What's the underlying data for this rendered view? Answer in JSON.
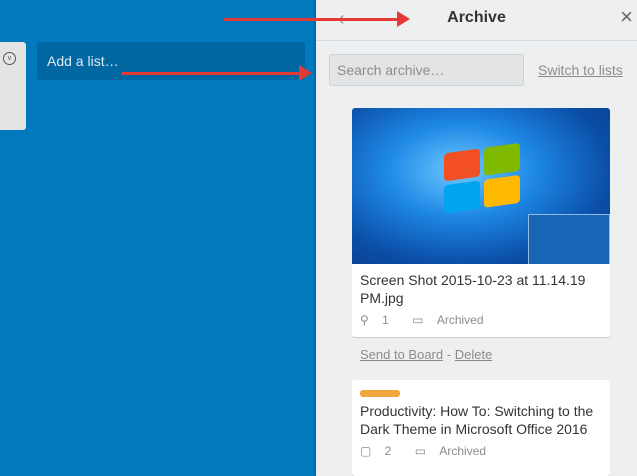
{
  "board": {
    "add_list_label": "Add a list…"
  },
  "panel": {
    "title": "Archive",
    "search_placeholder": "Search archive…",
    "switch_label": "Switch to lists"
  },
  "cards": [
    {
      "title": "Screen Shot 2015-10-23 at 11.14.19 PM.jpg",
      "attachments": "1",
      "status": "Archived",
      "actions": {
        "send": "Send to Board",
        "separator": "-",
        "delete": "Delete"
      }
    },
    {
      "title": "Productivity: How To: Switching to the Dark Theme in Microsoft Office 2016",
      "comments": "2",
      "status": "Archived",
      "label_color": "#f2a53c"
    }
  ],
  "colors": {
    "board": "#0079bf",
    "annotation_arrow": "#e53935"
  }
}
